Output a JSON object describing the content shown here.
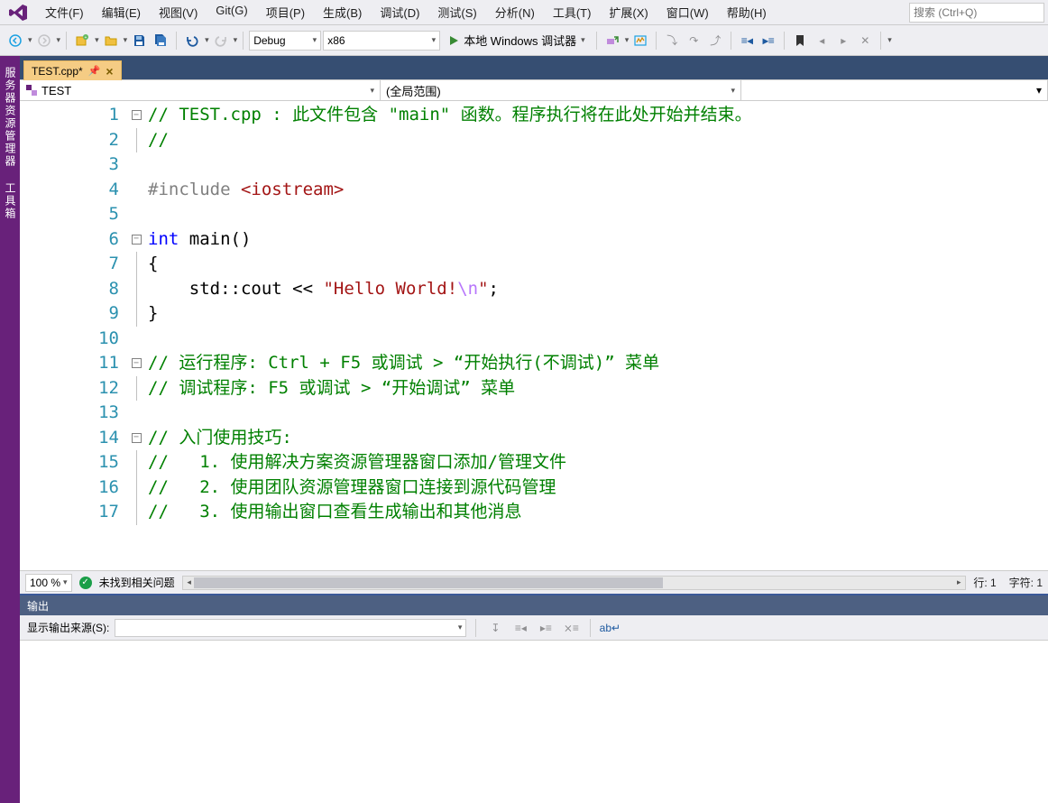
{
  "menus": [
    "文件(F)",
    "编辑(E)",
    "视图(V)",
    "Git(G)",
    "项目(P)",
    "生成(B)",
    "调试(D)",
    "测试(S)",
    "分析(N)",
    "工具(T)",
    "扩展(X)",
    "窗口(W)",
    "帮助(H)"
  ],
  "search_placeholder": "搜索 (Ctrl+Q)",
  "toolbar": {
    "config": "Debug",
    "platform": "x86",
    "run_label": "本地 Windows 调试器"
  },
  "side_tabs": [
    "服务器资源管理器",
    "工具箱"
  ],
  "file_tab": "TEST.cpp*",
  "nav": {
    "scope1": "TEST",
    "scope2": "(全局范围)"
  },
  "code_lines": [
    {
      "n": 1,
      "fold": "-",
      "seg": [
        {
          "t": "// TEST.cpp : 此文件包含 \"main\" 函数。程序执行将在此处开始并结束。",
          "c": "c-comment"
        }
      ]
    },
    {
      "n": 2,
      "fold": "|",
      "seg": [
        {
          "t": "//",
          "c": "c-comment"
        }
      ]
    },
    {
      "n": 3,
      "fold": "",
      "seg": [
        {
          "t": "",
          "c": "c-txt"
        }
      ]
    },
    {
      "n": 4,
      "fold": "",
      "seg": [
        {
          "t": "#include ",
          "c": "c-pp"
        },
        {
          "t": "<iostream>",
          "c": "c-inc"
        }
      ]
    },
    {
      "n": 5,
      "fold": "",
      "seg": [
        {
          "t": "",
          "c": "c-txt"
        }
      ]
    },
    {
      "n": 6,
      "fold": "-",
      "seg": [
        {
          "t": "int",
          "c": "c-kw"
        },
        {
          "t": " main()",
          "c": "c-txt"
        }
      ]
    },
    {
      "n": 7,
      "fold": "|",
      "seg": [
        {
          "t": "{",
          "c": "c-txt"
        }
      ]
    },
    {
      "n": 8,
      "fold": "|",
      "seg": [
        {
          "t": "    std::cout << ",
          "c": "c-txt"
        },
        {
          "t": "\"Hello World!",
          "c": "c-str"
        },
        {
          "t": "\\n",
          "c": "c-esc"
        },
        {
          "t": "\"",
          "c": "c-str"
        },
        {
          "t": ";",
          "c": "c-txt"
        }
      ]
    },
    {
      "n": 9,
      "fold": "|",
      "seg": [
        {
          "t": "}",
          "c": "c-txt"
        }
      ]
    },
    {
      "n": 10,
      "fold": "",
      "seg": [
        {
          "t": "",
          "c": "c-txt"
        }
      ]
    },
    {
      "n": 11,
      "fold": "-",
      "seg": [
        {
          "t": "// 运行程序: Ctrl + F5 或调试 > “开始执行(不调试)” 菜单",
          "c": "c-comment"
        }
      ]
    },
    {
      "n": 12,
      "fold": "|",
      "seg": [
        {
          "t": "// 调试程序: F5 或调试 > “开始调试” 菜单",
          "c": "c-comment"
        }
      ]
    },
    {
      "n": 13,
      "fold": "",
      "seg": [
        {
          "t": "",
          "c": "c-txt"
        }
      ]
    },
    {
      "n": 14,
      "fold": "-",
      "seg": [
        {
          "t": "// 入门使用技巧: ",
          "c": "c-comment"
        }
      ]
    },
    {
      "n": 15,
      "fold": "|",
      "seg": [
        {
          "t": "//   1. 使用解决方案资源管理器窗口添加/管理文件",
          "c": "c-comment"
        }
      ]
    },
    {
      "n": 16,
      "fold": "|",
      "seg": [
        {
          "t": "//   2. 使用团队资源管理器窗口连接到源代码管理",
          "c": "c-comment"
        }
      ]
    },
    {
      "n": 17,
      "fold": "|",
      "seg": [
        {
          "t": "//   3. 使用输出窗口查看生成输出和其他消息",
          "c": "c-comment"
        }
      ]
    }
  ],
  "status": {
    "zoom": "100 %",
    "issues": "未找到相关问题",
    "line": "行: 1",
    "col": "字符: 1"
  },
  "output": {
    "title": "输出",
    "source_label": "显示输出来源(S):"
  }
}
